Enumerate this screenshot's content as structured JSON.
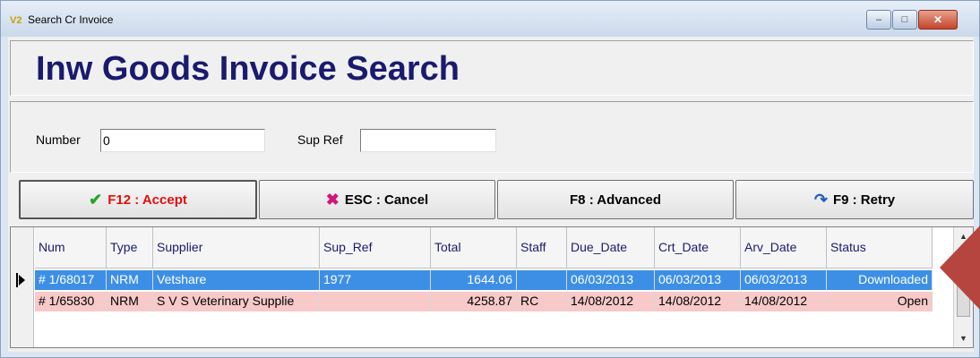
{
  "window": {
    "title": "Search Cr Invoice",
    "icon": "app-icon",
    "icon_glyph": "V2",
    "minimize": "–",
    "maximize": "□",
    "close": "✕"
  },
  "header": {
    "title": "Inw Goods Invoice Search"
  },
  "filters": {
    "number_label": "Number",
    "number_value": "0",
    "supref_label": "Sup Ref",
    "supref_value": ""
  },
  "buttons": {
    "accept": {
      "label": "F12 : Accept",
      "icon": "check-icon",
      "glyph": "✔"
    },
    "cancel": {
      "label": "ESC : Cancel",
      "icon": "x-icon",
      "glyph": "✖"
    },
    "advanced": {
      "label": "F8 : Advanced"
    },
    "retry": {
      "label": "F9 : Retry",
      "icon": "retry-icon",
      "glyph": "↷"
    }
  },
  "grid": {
    "columns": [
      "Num",
      "Type",
      "Supplier",
      "Sup_Ref",
      "Total",
      "Staff",
      "Due_Date",
      "Crt_Date",
      "Arv_Date",
      "Status"
    ],
    "rows": [
      [
        "# 1/68017",
        "NRM",
        "Vetshare",
        "1977",
        "1644.06",
        "",
        "06/03/2013",
        "06/03/2013",
        "06/03/2013",
        "Downloaded"
      ],
      [
        "# 1/65830",
        "NRM",
        "S V S Veterinary Supplie",
        "",
        "4258.87",
        "RC",
        "14/08/2012",
        "14/08/2012",
        "14/08/2012",
        "Open"
      ]
    ],
    "selected_row": 0
  },
  "colors": {
    "title": "#1a1a6e",
    "selected_row": "#3d8fe6",
    "open_row": "#f7c9c9",
    "pointer": "#b5453e"
  }
}
